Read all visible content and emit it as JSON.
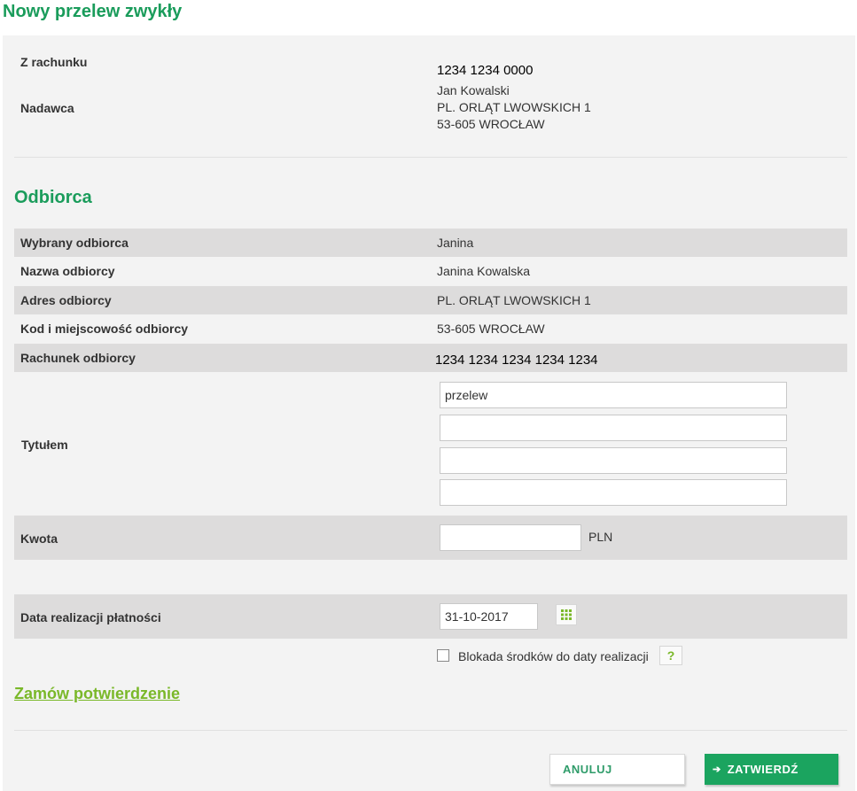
{
  "page": {
    "title": "Nowy przelew zwykły"
  },
  "sender": {
    "account_label": "Z rachunku",
    "account_value": "1234 1234 0000",
    "name_label": "Nadawca",
    "name": "Jan Kowalski",
    "address_line1": "PL. ORLĄT LWOWSKICH 1",
    "address_line2": "53-605 WROCŁAW"
  },
  "recipient": {
    "section_title": "Odbiorca",
    "rows": [
      {
        "label": "Wybrany odbiorca",
        "value": "Janina"
      },
      {
        "label": "Nazwa odbiorcy",
        "value": "Janina Kowalska"
      },
      {
        "label": "Adres odbiorcy",
        "value": "PL. ORLĄT LWOWSKICH 1"
      },
      {
        "label": "Kod i miejscowość odbiorcy",
        "value": "53-605 WROCŁAW"
      },
      {
        "label": "Rachunek odbiorcy",
        "value": "1234 1234 1234 1234 1234"
      }
    ]
  },
  "title_field": {
    "label": "Tytułem",
    "lines": [
      "przelew",
      "",
      "",
      ""
    ]
  },
  "amount": {
    "label": "Kwota",
    "value": "",
    "currency": "PLN"
  },
  "date": {
    "label": "Data realizacji płatności",
    "value": "31-10-2017",
    "calendar_icon": "calendar-grid-icon"
  },
  "block_funds": {
    "label": "Blokada środków do daty realizacji",
    "checked": false,
    "help_text": "?"
  },
  "confirmation_link": "Zamów potwierdzenie",
  "actions": {
    "cancel_label": "ANULUJ",
    "submit_arrow": "➔",
    "submit_label": "ZATWIERDŹ"
  },
  "colors": {
    "brand_green": "#1a9c5b",
    "link_green": "#7ab829",
    "panel_bg": "#f3f3f3",
    "row_shade": "#dddcdc",
    "button_green": "#1ba45f"
  }
}
